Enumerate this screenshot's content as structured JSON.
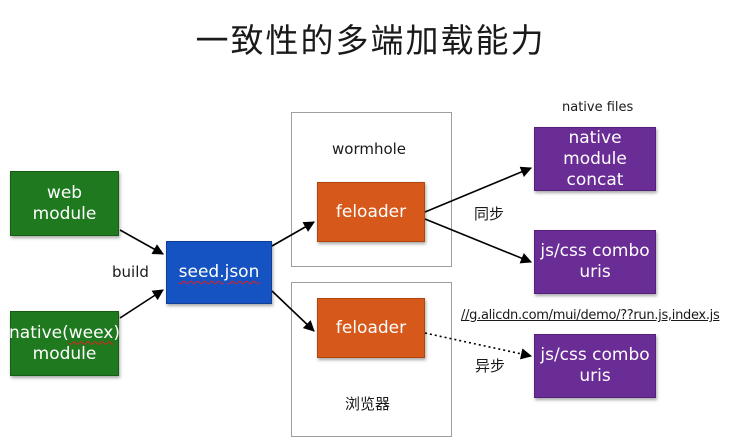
{
  "title": "一致性的多端加载能力",
  "nodes": {
    "web_module": [
      "web",
      "module"
    ],
    "native_weex_module": [
      "native(weex)",
      "module"
    ],
    "seed_json": "seed.json",
    "feloader_top": "feloader",
    "feloader_bottom": "feloader",
    "native_module_concat": [
      "native module",
      "concat"
    ],
    "jscss_combo_top": [
      "js/css combo",
      "uris"
    ],
    "jscss_combo_bottom": [
      "js/css combo",
      "uris"
    ]
  },
  "labels": {
    "build": "build",
    "wormhole": "wormhole",
    "browser": "浏览器",
    "native_files": "native files",
    "sync": "同步",
    "async": "异步",
    "cdn_url": "//g.alicdn.com/mui/demo/??run.js,index.js"
  },
  "colors": {
    "source": "#1f7a1f",
    "seed": "#1552c2",
    "loader": "#d6581a",
    "output": "#6a2c95"
  }
}
